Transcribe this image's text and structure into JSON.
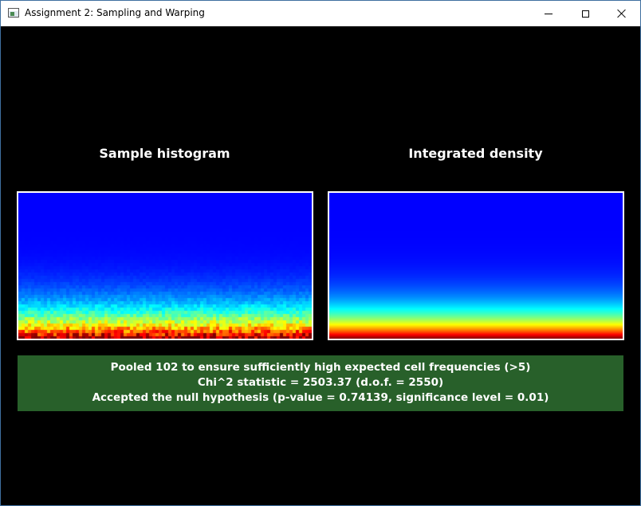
{
  "window": {
    "title": "Assignment 2: Sampling and Warping",
    "icon": "app-window-icon",
    "controls": [
      "minimize-icon",
      "maximize-icon",
      "close-icon"
    ]
  },
  "panels": {
    "left_title": "Sample histogram",
    "right_title": "Integrated density"
  },
  "colors": {
    "background": "#000000",
    "plot_border": "#ffffff",
    "result_background": "#28602a",
    "result_text": "#ffffff",
    "colormap_low": "#0010ff",
    "colormap_high": "#ff2000"
  },
  "result": {
    "line1": "Pooled 102 to ensure sufficiently high expected cell frequencies (>5)",
    "line2": "Chi^2 statistic = 2503.37 (d.o.f. = 2550)",
    "line3": "Accepted the null hypothesis (p-value = 0.74139, significance level = 0.01)"
  }
}
